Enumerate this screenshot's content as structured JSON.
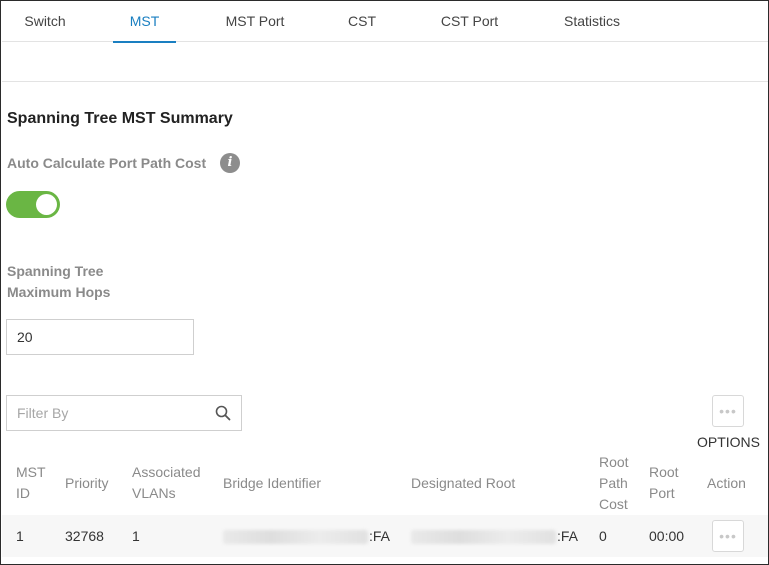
{
  "tabs": [
    {
      "label": "Switch"
    },
    {
      "label": "MST"
    },
    {
      "label": "MST Port"
    },
    {
      "label": "CST"
    },
    {
      "label": "CST Port"
    },
    {
      "label": "Statistics"
    }
  ],
  "active_tab": "MST",
  "section_title": "Spanning Tree MST Summary",
  "auto_calc": {
    "label": "Auto Calculate Port Path Cost",
    "enabled": true
  },
  "max_hops": {
    "label_line1": "Spanning Tree",
    "label_line2": "Maximum Hops",
    "value": "20"
  },
  "filter": {
    "placeholder": "Filter By"
  },
  "options_label": "OPTIONS",
  "colors": {
    "accent": "#1a7fc1",
    "toggle_on": "#6ab644"
  },
  "table": {
    "headers": {
      "mst_id": [
        "MST",
        "ID"
      ],
      "priority": "Priority",
      "associated_vlans": [
        "Associated",
        "VLANs"
      ],
      "bridge_identifier": "Bridge Identifier",
      "designated_root": "Designated Root",
      "root_path_cost": [
        "Root",
        "Path",
        "Cost"
      ],
      "root_port": [
        "Root",
        "Port"
      ],
      "action": "Action"
    },
    "rows": [
      {
        "mst_id": "1",
        "priority": "32768",
        "associated_vlans": "1",
        "bridge_identifier_suffix": ":FA",
        "designated_root_suffix": ":FA",
        "root_path_cost": "0",
        "root_port": "00:00"
      }
    ]
  }
}
